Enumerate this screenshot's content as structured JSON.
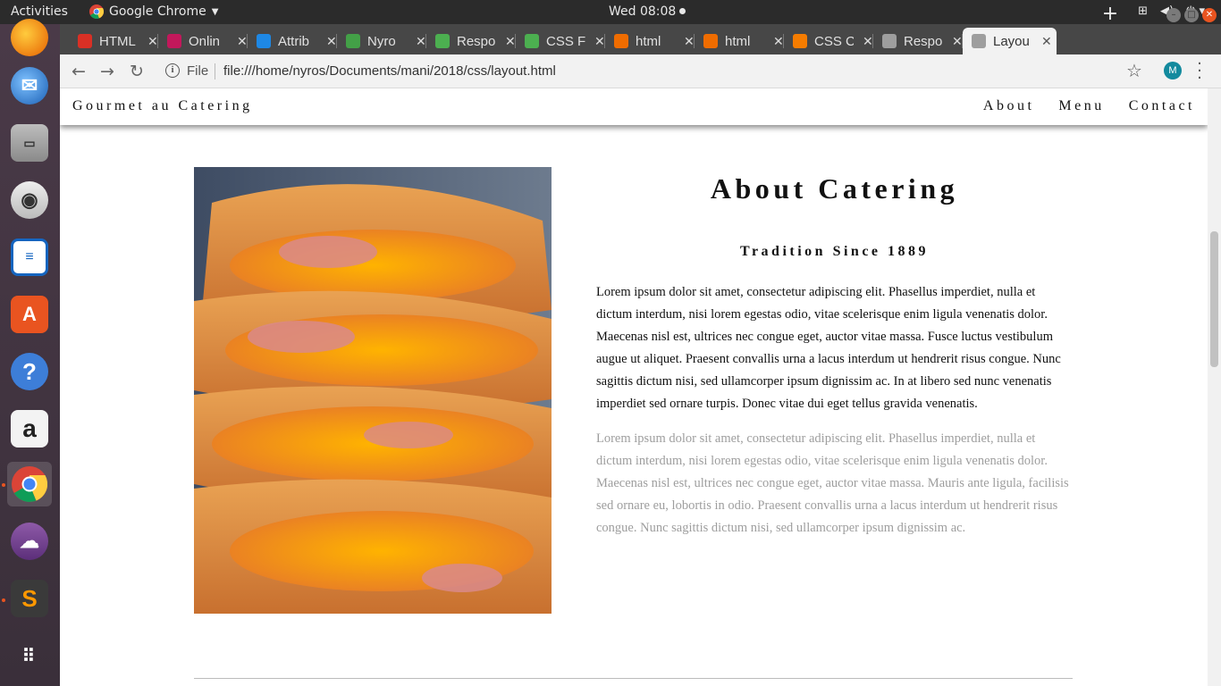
{
  "os": {
    "activities": "Activities",
    "app_name": "Google Chrome",
    "clock": "Wed 08:08"
  },
  "browser": {
    "tabs": [
      {
        "title": "HTML",
        "color": "#d93025"
      },
      {
        "title": "Onlin",
        "color": "#c2185b"
      },
      {
        "title": "Attrib",
        "color": "#1e88e5"
      },
      {
        "title": "Nyro",
        "color": "#43a047"
      },
      {
        "title": "Respo",
        "color": "#4caf50"
      },
      {
        "title": "CSS F",
        "color": "#4caf50"
      },
      {
        "title": "html",
        "color": "#ef6c00"
      },
      {
        "title": "html",
        "color": "#ef6c00"
      },
      {
        "title": "CSS C",
        "color": "#f57c00"
      },
      {
        "title": "Respo",
        "color": "#9e9e9e"
      },
      {
        "title": "Layou",
        "color": "#9e9e9e",
        "active": true
      }
    ],
    "url_scheme": "File",
    "url": "file:///home/nyros/Documents/mani/2018/css/layout.html",
    "profile_initial": "M"
  },
  "site": {
    "brand": "Gourmet au Catering",
    "nav": [
      "About",
      "Menu",
      "Contact"
    ],
    "about": {
      "title": "About Catering",
      "subtitle": "Tradition Since 1889",
      "paragraph_1": "Lorem ipsum dolor sit amet, consectetur adipiscing elit. Phasellus imperdiet, nulla et dictum interdum, nisi lorem egestas odio, vitae scelerisque enim ligula venenatis dolor. Maecenas nisl est, ultrices nec congue eget, auctor vitae massa. Fusce luctus vestibulum augue ut aliquet. Praesent convallis urna a lacus interdum ut hendrerit risus congue. Nunc sagittis dictum nisi, sed ullamcorper ipsum dignissim ac. In at libero sed nunc venenatis imperdiet sed ornare turpis. Donec vitae dui eget tellus gravida venenatis.",
      "paragraph_2": "Lorem ipsum dolor sit amet, consectetur adipiscing elit. Phasellus imperdiet, nulla et dictum interdum, nisi lorem egestas odio, vitae scelerisque enim ligula venenatis dolor. Maecenas nisl est, ultrices nec congue eget, auctor vitae massa. Mauris ante ligula, facilisis sed ornare eu, lobortis in odio. Praesent convallis urna a lacus interdum ut hendrerit risus congue. Nunc sagittis dictum nisi, sed ullamcorper ipsum dignissim ac."
    }
  }
}
